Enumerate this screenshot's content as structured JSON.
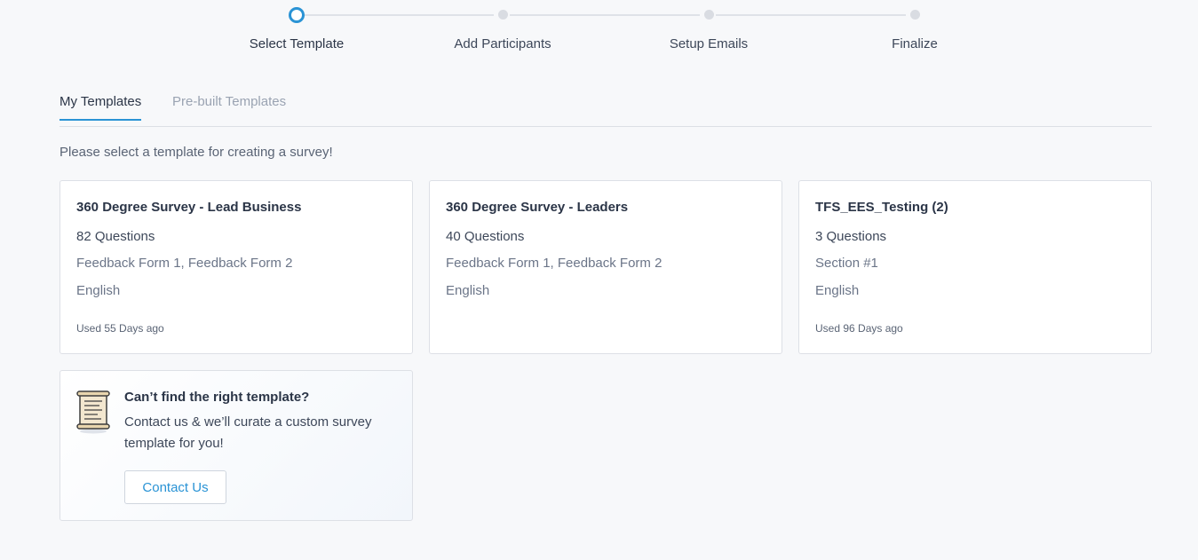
{
  "stepper": {
    "steps": [
      {
        "label": "Select Template",
        "active": true
      },
      {
        "label": "Add Participants",
        "active": false
      },
      {
        "label": "Setup Emails",
        "active": false
      },
      {
        "label": "Finalize",
        "active": false
      }
    ]
  },
  "tabs": {
    "my_templates": "My Templates",
    "prebuilt_templates": "Pre-built Templates"
  },
  "instruction": "Please select a template for creating a survey!",
  "templates": [
    {
      "title": "360 Degree Survey - Lead Business",
      "questions": "82 Questions",
      "forms": "Feedback Form 1, Feedback Form 2",
      "language": "English",
      "used": "Used 55 Days ago"
    },
    {
      "title": "360 Degree Survey - Leaders",
      "questions": "40 Questions",
      "forms": "Feedback Form 1, Feedback Form 2",
      "language": "English",
      "used": ""
    },
    {
      "title": "TFS_EES_Testing (2)",
      "questions": "3 Questions",
      "forms": "Section #1",
      "language": "English",
      "used": "Used 96 Days ago"
    }
  ],
  "help": {
    "icon": "scroll-icon",
    "title": "Can’t find the right template?",
    "text": "Contact us & we’ll curate a custom survey template for you!",
    "button": "Contact Us"
  },
  "colors": {
    "accent": "#2a93d5",
    "background": "#f7f8fa"
  }
}
